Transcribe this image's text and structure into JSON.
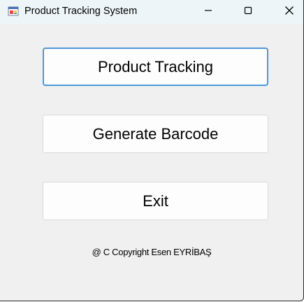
{
  "window": {
    "title": "Product Tracking System",
    "icon": "app-window-icon"
  },
  "controls": {
    "minimize_icon": "minimize-icon",
    "maximize_icon": "maximize-icon",
    "close_icon": "close-icon"
  },
  "menu": {
    "product_tracking_label": "Product Tracking",
    "generate_barcode_label": "Generate Barcode",
    "exit_label": "Exit"
  },
  "footer": {
    "copyright": "@ C Copyright Esen EYRİBAŞ"
  },
  "colors": {
    "window_bg": "#f0f0f0",
    "titlebar_bg": "#eef5f9",
    "focus_border": "#4f97d8"
  }
}
